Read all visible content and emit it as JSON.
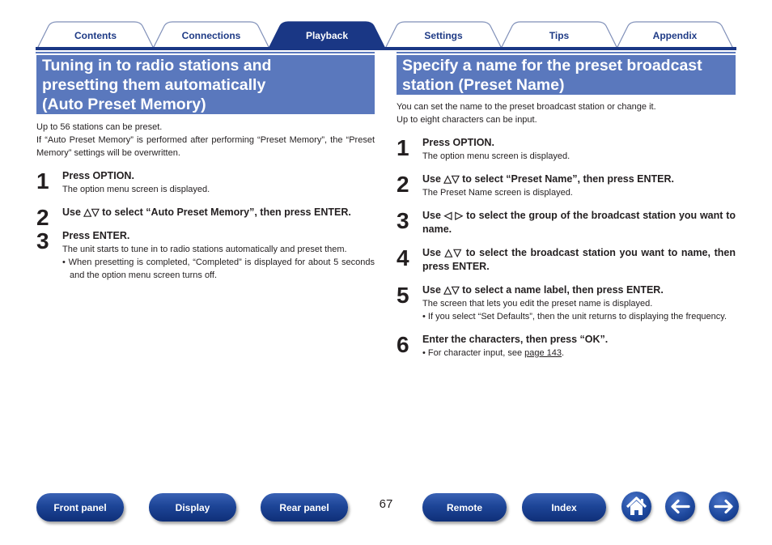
{
  "tabs": [
    {
      "label": "Contents",
      "active": false
    },
    {
      "label": "Connections",
      "active": false
    },
    {
      "label": "Playback",
      "active": true
    },
    {
      "label": "Settings",
      "active": false
    },
    {
      "label": "Tips",
      "active": false
    },
    {
      "label": "Appendix",
      "active": false
    }
  ],
  "colors": {
    "tab_active": "#1a3785",
    "heading_bg": "#5a78bd",
    "nav_button": "#1d4597"
  },
  "left": {
    "heading": "Tuning in to radio stations and presetting them automatically (Auto Preset Memory)",
    "heading_lines": [
      "Tuning in to radio stations and",
      "presetting them automatically",
      "(Auto Preset Memory)"
    ],
    "intro": [
      "Up to 56 stations can be preset.",
      "If “Auto Preset Memory” is performed after performing “Preset Memory”, the “Preset Memory” settings will be overwritten."
    ],
    "steps": [
      {
        "num": "1",
        "title": "Press OPTION.",
        "desc": "The option menu screen is displayed."
      },
      {
        "num": "2",
        "title": "Use △▽ to select “Auto Preset Memory”, then press ENTER."
      },
      {
        "num": "3",
        "title": "Press ENTER.",
        "desc": "The unit starts to tune in to radio stations automatically and preset them.",
        "bullet": "When presetting is completed, “Completed” is displayed for about 5 seconds and the option menu screen turns off."
      }
    ]
  },
  "right": {
    "heading_lines": [
      "Specify a name for the preset broadcast",
      "station (Preset Name)"
    ],
    "intro": [
      "You can set the name to the preset broadcast station or change it.",
      "Up to eight characters can be input."
    ],
    "steps": [
      {
        "num": "1",
        "title": "Press OPTION.",
        "desc": "The option menu screen is displayed."
      },
      {
        "num": "2",
        "title": "Use △▽ to select “Preset Name”, then press ENTER.",
        "desc": "The Preset Name screen is displayed."
      },
      {
        "num": "3",
        "title": "Use ◁ ▷ to select the group of the broadcast station you want to name."
      },
      {
        "num": "4",
        "title": "Use △▽ to select the broadcast station you want to name, then press ENTER."
      },
      {
        "num": "5",
        "title": "Use △▽ to select a name label, then press ENTER.",
        "desc": "The screen that lets you edit the preset name is displayed.",
        "bullet": "If you select “Set Defaults”, then the unit returns to displaying the frequency."
      },
      {
        "num": "6",
        "title": "Enter the characters, then press “OK”.",
        "bullet_prefix": "For character input, see ",
        "bullet_link": "page 143",
        "bullet_suffix": "."
      }
    ]
  },
  "footer": {
    "buttons": [
      "Front panel",
      "Display",
      "Rear panel",
      "Remote",
      "Index"
    ],
    "page_number": "67",
    "icons": [
      "home-icon",
      "back-arrow-icon",
      "forward-arrow-icon"
    ]
  }
}
